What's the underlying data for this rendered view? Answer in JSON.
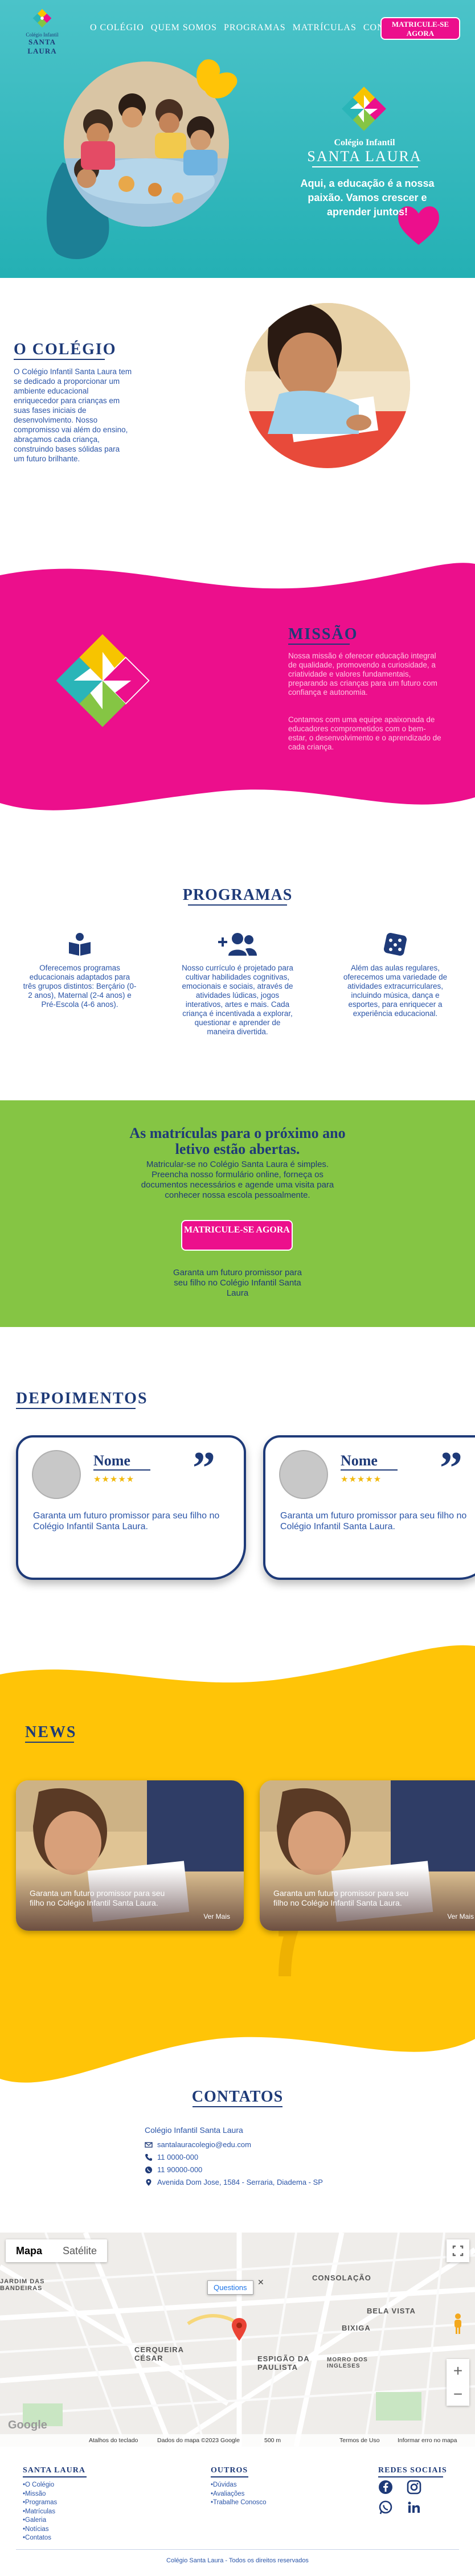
{
  "brand": {
    "logo_line1": "Colégio Infantil",
    "logo_line2": "SANTA LAURA"
  },
  "nav": {
    "items": [
      "O COLÉGIO",
      "QUEM SOMOS",
      "PROGRAMAS",
      "MATRÍCULAS",
      "CONTATO"
    ],
    "cta": "MATRICULE-SE AGORA"
  },
  "hero": {
    "name_line1": "Colégio Infantil",
    "name_line2": "SANTA LAURA",
    "tagline": "Aqui, a educação é a nossa paixão. Vamos crescer e aprender juntos!"
  },
  "colegio": {
    "title": "O COLÉGIO",
    "text": "O Colégio Infantil Santa Laura tem se dedicado a proporcionar um ambiente educacional enriquecedor para crianças em suas fases iniciais de desenvolvimento. Nosso compromisso vai além do ensino, abraçamos cada criança, construindo bases sólidas para um futuro brilhante."
  },
  "missao": {
    "title": "MISSÃO",
    "p1": "Nossa missão é oferecer educação integral de qualidade, promovendo a curiosidade, a criatividade e valores fundamentais, preparando as crianças para um futuro com confiança e autonomia.",
    "p2": "Contamos com uma equipe apaixonada de educadores comprometidos com o bem-estar, o desenvolvimento e o aprendizado de cada criança."
  },
  "programas": {
    "title": "PROGRAMAS",
    "items": [
      {
        "icon": "book-reader-icon",
        "text": "Oferecemos programas educacionais adaptados para três grupos distintos: Berçário (0-2 anos), Maternal (2-4 anos) e Pré-Escola (4-6 anos)."
      },
      {
        "icon": "user-plus-icon",
        "text": "Nosso currículo é projetado para cultivar habilidades cognitivas, emocionais e sociais, através de atividades lúdicas, jogos interativos, artes e mais. Cada criança é incentivada a explorar, questionar e aprender de maneira divertida."
      },
      {
        "icon": "dice-icon",
        "text": "Além das aulas regulares, oferecemos uma variedade de atividades extracurriculares, incluindo música, dança e esportes, para enriquecer a experiência educacional."
      }
    ]
  },
  "matriculas": {
    "title": "As matrículas para o próximo ano letivo estão abertas.",
    "text": "Matricular-se no Colégio Santa Laura é simples. Preencha nosso formulário online, forneça os documentos necessários e agende uma visita para conhecer nossa escola pessoalmente.",
    "cta": "MATRICULE-SE AGORA",
    "footer": "Garanta um futuro promissor para seu filho no Colégio Infantil Santa Laura"
  },
  "depoimentos": {
    "title": "DEPOIMENTOS",
    "cards": [
      {
        "avatar_label": "user",
        "name": "Nome",
        "stars": "★★★★★",
        "text": "Garanta um futuro promissor para seu filho no Colégio Infantil Santa Laura."
      },
      {
        "avatar_label": "user",
        "name": "Nome",
        "stars": "★★★★★",
        "text": "Garanta um futuro promissor para seu filho no Colégio Infantil Santa Laura."
      }
    ]
  },
  "news": {
    "title": "NEWS",
    "cards": [
      {
        "text": "Garanta um futuro promissor para seu filho no Colégio Infantil Santa Laura.",
        "link": "Ver Mais"
      },
      {
        "text": "Garanta um futuro promissor para seu filho no Colégio Infantil Santa Laura.",
        "link": "Ver Mais"
      }
    ]
  },
  "contatos": {
    "title": "CONTATOS",
    "name": "Colégio Infantil Santa Laura",
    "email": "santalauracolegio@edu.com",
    "phone": "11 0000-000",
    "whatsapp": "11 90000-000",
    "address": "Avenida Dom Jose, 1584 - Serraria, Diadema - SP"
  },
  "map": {
    "tab_map": "Mapa",
    "tab_satellite": "Satélite",
    "label": "Questions",
    "places": [
      "CONSOLAÇÃO",
      "BELA VISTA",
      "BIXIGA",
      "JARDIM DAS BANDEIRAS",
      "CERQUEIRA CÉSAR",
      "ESPIGÃO DA PAULISTA",
      "MORRO DOS INGLESES"
    ],
    "footer_shortcuts": "Atalhos do teclado",
    "footer_data": "Dados do mapa ©2023 Google",
    "footer_scale": "500 m",
    "footer_terms": "Termos de Uso",
    "footer_report": "Informar erro no mapa",
    "google": "Google"
  },
  "footer": {
    "col1_title": "SANTA LAURA",
    "col1_items": [
      "O Colégio",
      "Missão",
      "Programas",
      "Matrículas",
      "Galeria",
      "Notícias",
      "Contatos"
    ],
    "col2_title": "OUTROS",
    "col2_items": [
      "Dúvidas",
      "Avaliações",
      "Trabalhe Conosco"
    ],
    "col3_title": "REDES SOCIAIS",
    "copyright": "Colégio Santa Laura - Todos os direitos reservados"
  },
  "colors": {
    "navy": "#1e3a78",
    "teal": "#2ab5b8",
    "pink": "#ec0f8c",
    "green": "#85c544",
    "yellow": "#ffc407"
  }
}
